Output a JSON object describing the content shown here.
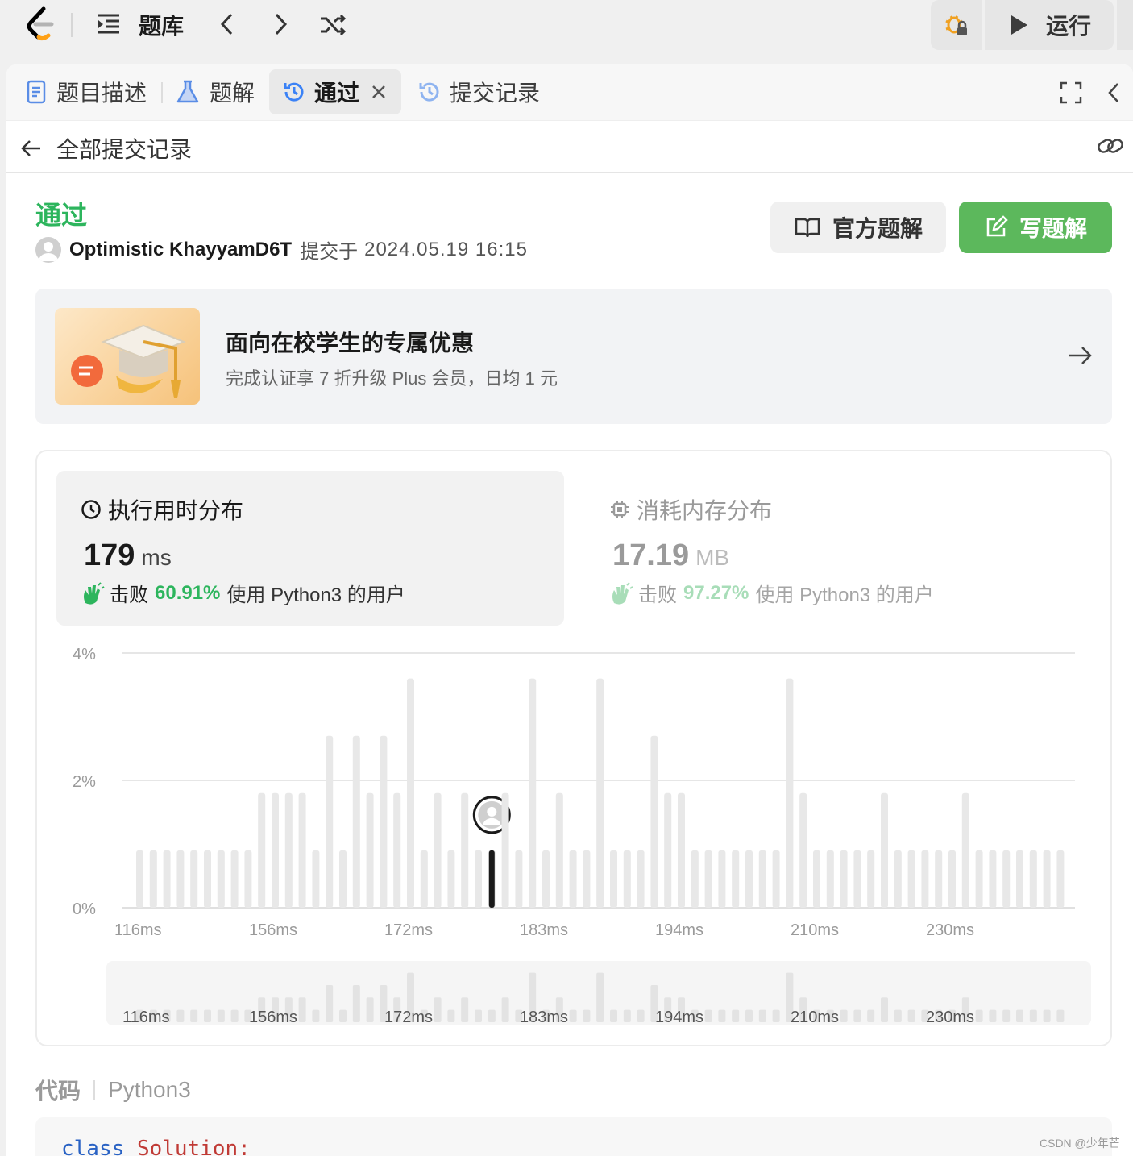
{
  "topbar": {
    "problem_bank": "题库",
    "run": "运行"
  },
  "tabs": [
    {
      "label": "题目描述"
    },
    {
      "label": "题解"
    },
    {
      "label": "通过"
    },
    {
      "label": "提交记录"
    }
  ],
  "subheader": {
    "back_label": "全部提交记录"
  },
  "submission": {
    "status": "通过",
    "user": "Optimistic KhayyamD6T",
    "submitted_prefix": "提交于",
    "datetime": "2024.05.19 16:15",
    "official_solution": "官方题解",
    "write_solution": "写题解"
  },
  "promo": {
    "title": "面向在校学生的专属优惠",
    "subtitle": "完成认证享 7 折升级 Plus 会员，日均 1 元"
  },
  "runtime": {
    "title": "执行用时分布",
    "value": "179",
    "unit": "ms",
    "beat_prefix": "击败",
    "beat_percent": "60.91%",
    "beat_suffix": "使用 Python3 的用户"
  },
  "memory": {
    "title": "消耗内存分布",
    "value": "17.19",
    "unit": "MB",
    "beat_prefix": "击败",
    "beat_percent": "97.27%",
    "beat_suffix": "使用 Python3 的用户"
  },
  "chart_data": {
    "type": "bar",
    "ylabel_ticks": [
      "4%",
      "2%",
      "0%"
    ],
    "ylim": [
      0,
      4
    ],
    "x_tick_labels": [
      "116ms",
      "156ms",
      "172ms",
      "183ms",
      "194ms",
      "210ms",
      "230ms"
    ],
    "values": [
      0.9,
      0.9,
      0.9,
      0.9,
      0.9,
      0.9,
      0.9,
      0.9,
      0.9,
      1.8,
      1.8,
      1.8,
      1.8,
      0.9,
      2.7,
      0.9,
      2.7,
      1.8,
      2.7,
      1.8,
      3.6,
      0.9,
      1.8,
      0.9,
      1.8,
      0.9,
      0.9,
      1.8,
      0.9,
      3.6,
      0.9,
      1.8,
      0.9,
      0.9,
      3.6,
      0.9,
      0.9,
      0.9,
      2.7,
      1.8,
      1.8,
      0.9,
      0.9,
      0.9,
      0.9,
      0.9,
      0.9,
      0.9,
      3.6,
      1.8,
      0.9,
      0.9,
      0.9,
      0.9,
      0.9,
      1.8,
      0.9,
      0.9,
      0.9,
      0.9,
      0.9,
      1.8,
      0.9,
      0.9,
      0.9,
      0.9,
      0.9,
      0.9,
      0.9
    ],
    "highlight_index": 26,
    "highlight_value": 0.9,
    "grid": true,
    "colors": {
      "bar": "#e8e8e8",
      "highlight": "#1a1a1a"
    }
  },
  "code": {
    "label": "代码",
    "language": "Python3",
    "first_line_kw": "class",
    "first_line_name": "Solution:"
  },
  "watermark": "CSDN @少年芒",
  "colors": {
    "green": "#5cb85c",
    "accent_green": "#2db55d",
    "blue": "#3b82f6",
    "gold": "#f0a020"
  }
}
